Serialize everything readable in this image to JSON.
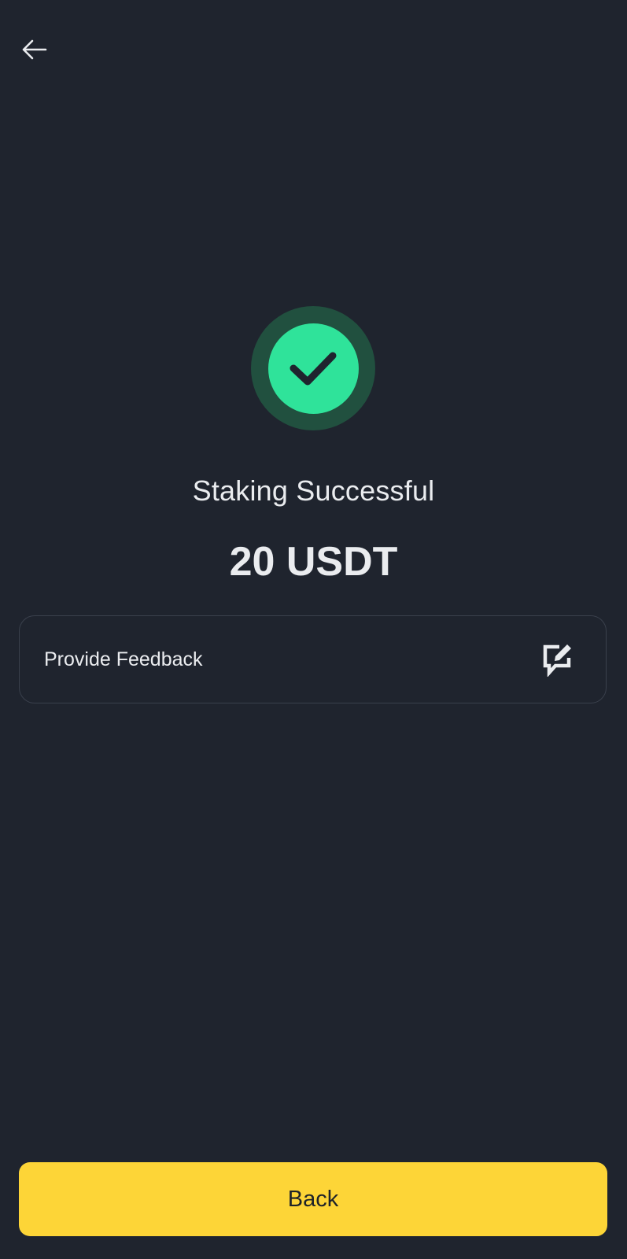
{
  "header": {
    "back_icon": "arrow-left-icon"
  },
  "status": {
    "icon": "check-circle-icon",
    "title": "Staking Successful",
    "amount": "20 USDT"
  },
  "feedback": {
    "label": "Provide Feedback",
    "icon": "edit-feedback-icon"
  },
  "footer": {
    "back_label": "Back"
  },
  "colors": {
    "background": "#1f242e",
    "success": "#2fe39a",
    "success_ring": "#21503f",
    "primary": "#fdd537",
    "text": "#eaecef",
    "border": "#3a404c"
  }
}
